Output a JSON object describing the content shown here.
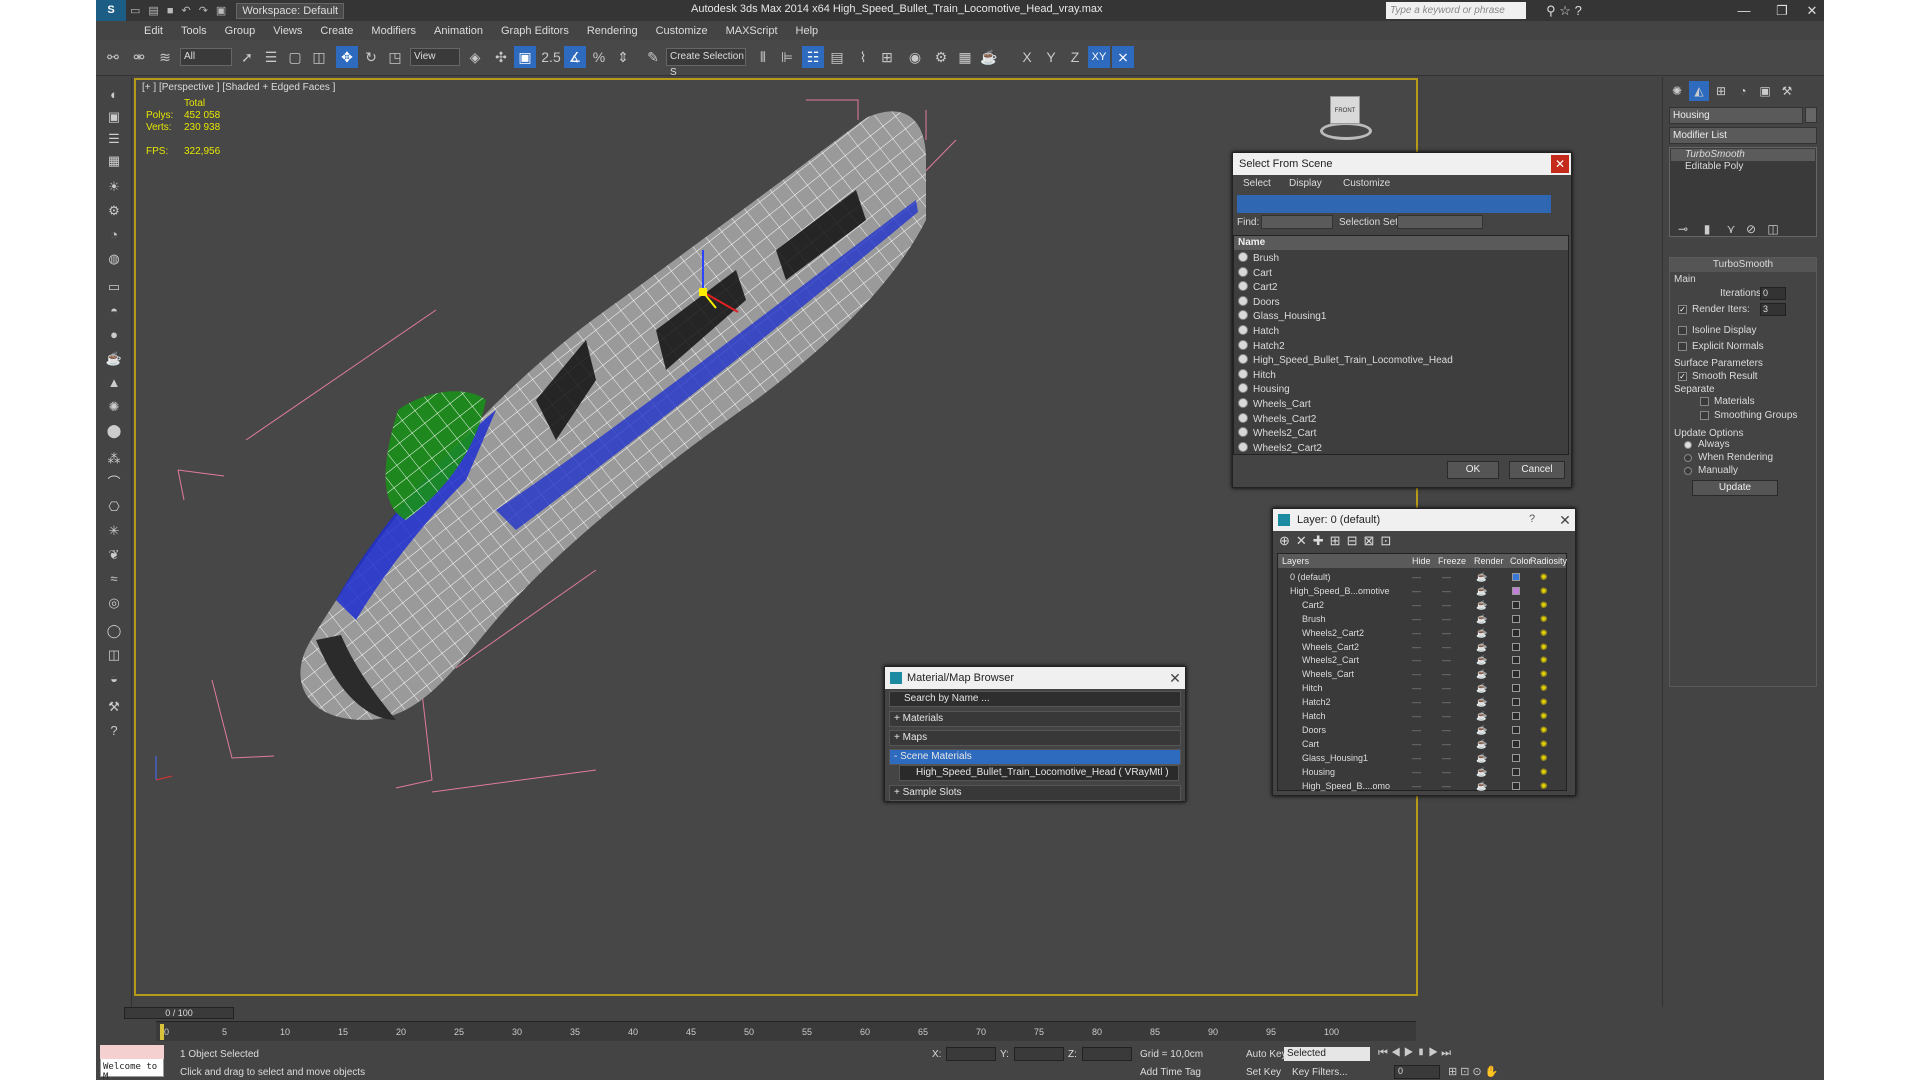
{
  "app": {
    "title": "Autodesk 3ds Max  2014 x64    High_Speed_Bullet_Train_Locomotive_Head_vray.max",
    "workspace": "Workspace: Default",
    "search_placeholder": "Type a keyword or phrase"
  },
  "menu": [
    "Edit",
    "Tools",
    "Group",
    "Views",
    "Create",
    "Modifiers",
    "Animation",
    "Graph Editors",
    "Rendering",
    "Customize",
    "MAXScript",
    "Help"
  ],
  "toolbar": {
    "filter": "All",
    "view": "View",
    "selection_set": "Create Selection S",
    "spinner_snap": "2.5",
    "axes": [
      "X",
      "Y",
      "Z",
      "XY"
    ]
  },
  "viewport": {
    "label": "[+ ] [Perspective ] [Shaded + Edged Faces ]",
    "stats": {
      "total": "Total",
      "polys_label": "Polys:",
      "polys": "452 058",
      "verts_label": "Verts:",
      "verts": "230 938",
      "fps_label": "FPS:",
      "fps": "322,956"
    },
    "viewcube_label": "FRONT"
  },
  "command_panel": {
    "object_name": "Housing",
    "modifier_list": "Modifier List",
    "stack": [
      "TurboSmooth",
      "Editable Poly"
    ],
    "rollout": "TurboSmooth",
    "main": "Main",
    "iterations_label": "Iterations:",
    "iterations": "0",
    "render_iters_label": "Render Iters:",
    "render_iters": "3",
    "isoline": "Isoline Display",
    "explicit": "Explicit Normals",
    "surface": "Surface Parameters",
    "smooth": "Smooth Result",
    "separate": "Separate",
    "materials": "Materials",
    "smoothing": "Smoothing Groups",
    "update_options": "Update Options",
    "always": "Always",
    "when_rendering": "When Rendering",
    "manually": "Manually",
    "update": "Update"
  },
  "select_dialog": {
    "title": "Select From Scene",
    "menu": [
      "Select",
      "Display",
      "Customize"
    ],
    "find": "Find:",
    "selection_set": "Selection Set:",
    "col_name": "Name",
    "items": [
      "Brush",
      "Cart",
      "Cart2",
      "Doors",
      "Glass_Housing1",
      "Hatch",
      "Hatch2",
      "High_Speed_Bullet_Train_Locomotive_Head",
      "Hitch",
      "Housing",
      "Wheels_Cart",
      "Wheels_Cart2",
      "Wheels2_Cart",
      "Wheels2_Cart2"
    ],
    "ok": "OK",
    "cancel": "Cancel"
  },
  "layer_dialog": {
    "title": "Layer: 0 (default)",
    "help": "?",
    "cols": [
      "Layers",
      "Hide",
      "Freeze",
      "Render",
      "Color",
      "Radiosity"
    ],
    "rows": [
      {
        "name": "0 (default)",
        "color": "#3a78d8"
      },
      {
        "name": "High_Speed_B...omotive",
        "color": "#c080d8"
      },
      {
        "name": "Cart2",
        "color": "#2a2a2a"
      },
      {
        "name": "Brush",
        "color": "#2a2a2a"
      },
      {
        "name": "Wheels2_Cart2",
        "color": "#2a2a2a"
      },
      {
        "name": "Wheels_Cart2",
        "color": "#2a2a2a"
      },
      {
        "name": "Wheels2_Cart",
        "color": "#2a2a2a"
      },
      {
        "name": "Wheels_Cart",
        "color": "#2a2a2a"
      },
      {
        "name": "Hitch",
        "color": "#2a2a2a"
      },
      {
        "name": "Hatch2",
        "color": "#2a2a2a"
      },
      {
        "name": "Hatch",
        "color": "#2a2a2a"
      },
      {
        "name": "Doors",
        "color": "#2a2a2a"
      },
      {
        "name": "Cart",
        "color": "#2a2a2a"
      },
      {
        "name": "Glass_Housing1",
        "color": "#2a2a2a"
      },
      {
        "name": "Housing",
        "color": "#2a2a2a"
      },
      {
        "name": "High_Speed_B....omo",
        "color": "#2a2a2a"
      }
    ]
  },
  "material_browser": {
    "title": "Material/Map Browser",
    "search": "Search by Name ...",
    "groups": [
      "+ Materials",
      "+ Maps",
      "- Scene Materials"
    ],
    "scene_item": "High_Speed_Bullet_Train_Locomotive_Head ( VRayMtl ) [Brush, Ca...",
    "sample_slots": "+ Sample Slots"
  },
  "timeline": {
    "frame": "0 / 100",
    "ticks": [
      "0",
      "5",
      "10",
      "15",
      "20",
      "25",
      "30",
      "35",
      "40",
      "45",
      "50",
      "55",
      "60",
      "65",
      "70",
      "75",
      "80",
      "85",
      "90",
      "95",
      "100"
    ]
  },
  "status": {
    "selected": "1 Object Selected",
    "prompt": "Click and drag to select and move objects",
    "maxscript": "Welcome to M",
    "x_label": "X:",
    "y_label": "Y:",
    "z_label": "Z:",
    "grid": "Grid = 10,0cm",
    "add_time_tag": "Add Time Tag",
    "auto_key": "Auto Key",
    "set_key": "Set Key",
    "key_mode": "Selected",
    "key_filters": "Key Filters...",
    "frame_value": "0"
  }
}
